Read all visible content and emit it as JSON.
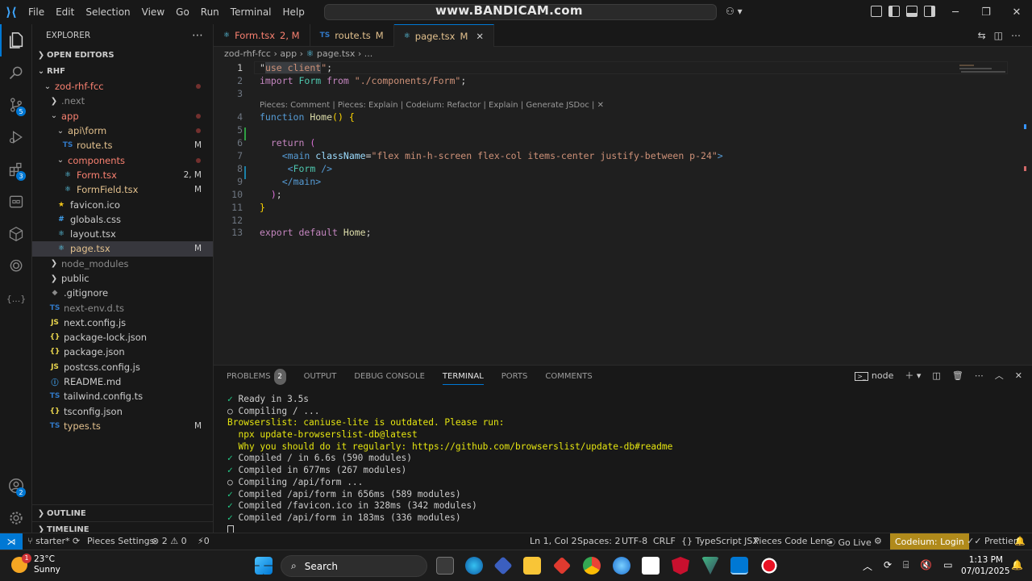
{
  "titlebar": {
    "menu": [
      "File",
      "Edit",
      "Selection",
      "View",
      "Go",
      "Run",
      "Terminal",
      "Help"
    ],
    "watermark": "www.BANDICAM.com"
  },
  "explorer": {
    "title": "EXPLORER",
    "open_editors": "OPEN EDITORS",
    "workspace": "RHF",
    "tree": [
      {
        "label": "zod-rhf-fcc",
        "depth": 0,
        "kind": "folder-open",
        "color": "err",
        "dot": true
      },
      {
        "label": ".next",
        "depth": 1,
        "kind": "folder",
        "color": "dim"
      },
      {
        "label": "app",
        "depth": 1,
        "kind": "folder-open",
        "color": "err",
        "dot": true
      },
      {
        "label": "api\\form",
        "depth": 2,
        "kind": "folder-open",
        "color": "mod",
        "dot": true
      },
      {
        "label": "route.ts",
        "depth": 3,
        "kind": "ts",
        "color": "mod",
        "status": "M"
      },
      {
        "label": "components",
        "depth": 2,
        "kind": "folder-open",
        "color": "err",
        "dot": true
      },
      {
        "label": "Form.tsx",
        "depth": 3,
        "kind": "react",
        "color": "err",
        "status": "2, M"
      },
      {
        "label": "FormField.tsx",
        "depth": 3,
        "kind": "react",
        "color": "mod",
        "status": "M"
      },
      {
        "label": "favicon.ico",
        "depth": 2,
        "kind": "fav",
        "color": "plain"
      },
      {
        "label": "globals.css",
        "depth": 2,
        "kind": "css",
        "color": "plain"
      },
      {
        "label": "layout.tsx",
        "depth": 2,
        "kind": "react",
        "color": "plain"
      },
      {
        "label": "page.tsx",
        "depth": 2,
        "kind": "react",
        "color": "mod",
        "status": "M",
        "selected": true
      },
      {
        "label": "node_modules",
        "depth": 1,
        "kind": "folder",
        "color": "dim"
      },
      {
        "label": "public",
        "depth": 1,
        "kind": "folder",
        "color": "plain"
      },
      {
        "label": ".gitignore",
        "depth": 1,
        "kind": "git",
        "color": "plain"
      },
      {
        "label": "next-env.d.ts",
        "depth": 1,
        "kind": "ts",
        "color": "dim"
      },
      {
        "label": "next.config.js",
        "depth": 1,
        "kind": "js",
        "color": "plain"
      },
      {
        "label": "package-lock.json",
        "depth": 1,
        "kind": "json",
        "color": "plain"
      },
      {
        "label": "package.json",
        "depth": 1,
        "kind": "json",
        "color": "plain"
      },
      {
        "label": "postcss.config.js",
        "depth": 1,
        "kind": "js",
        "color": "plain"
      },
      {
        "label": "README.md",
        "depth": 1,
        "kind": "info",
        "color": "plain"
      },
      {
        "label": "tailwind.config.ts",
        "depth": 1,
        "kind": "ts",
        "color": "plain"
      },
      {
        "label": "tsconfig.json",
        "depth": 1,
        "kind": "json",
        "color": "plain"
      },
      {
        "label": "types.ts",
        "depth": 1,
        "kind": "ts",
        "color": "mod",
        "status": "M"
      }
    ],
    "outline": "OUTLINE",
    "timeline": "TIMELINE"
  },
  "tabs": [
    {
      "label": "Form.tsx",
      "status": "2, M",
      "icon": "react",
      "kind": "err"
    },
    {
      "label": "route.ts",
      "status": "M",
      "icon": "ts",
      "kind": "mod"
    },
    {
      "label": "page.tsx",
      "status": "M",
      "icon": "react",
      "kind": "mod",
      "active": true,
      "close": "✕"
    }
  ],
  "breadcrumb": [
    "zod-rhf-fcc",
    "app",
    "page.tsx",
    "..."
  ],
  "code_lens": "Pieces: Comment | Pieces: Explain | Codeium: Refactor | Explain | Generate JSDoc | ✕",
  "code_lines": [
    {
      "n": "1",
      "tokens": [
        [
          "punc",
          "\""
        ],
        [
          "str hl",
          "use client"
        ],
        [
          "str",
          "\""
        ],
        [
          "punc",
          ";"
        ]
      ]
    },
    {
      "n": "2",
      "tokens": [
        [
          "kw",
          "import"
        ],
        [
          "punc",
          " "
        ],
        [
          "cls",
          "Form"
        ],
        [
          "punc",
          " "
        ],
        [
          "kw",
          "from"
        ],
        [
          "punc",
          " "
        ],
        [
          "str",
          "\"./components/Form\""
        ],
        [
          "punc",
          ";"
        ]
      ]
    },
    {
      "n": "3",
      "tokens": []
    },
    {
      "n": "4",
      "tokens": [
        [
          "kwb",
          "function"
        ],
        [
          "punc",
          " "
        ],
        [
          "fn",
          "Home"
        ],
        [
          "br1",
          "()"
        ],
        [
          "punc",
          " "
        ],
        [
          "br1",
          "{"
        ]
      ]
    },
    {
      "n": "5",
      "tokens": []
    },
    {
      "n": "6",
      "tokens": [
        [
          "punc",
          "  "
        ],
        [
          "kw",
          "return"
        ],
        [
          "punc",
          " "
        ],
        [
          "br2",
          "("
        ]
      ]
    },
    {
      "n": "7",
      "tokens": [
        [
          "punc",
          "    "
        ],
        [
          "tag",
          "<"
        ],
        [
          "tag",
          "main"
        ],
        [
          "punc",
          " "
        ],
        [
          "attr",
          "className"
        ],
        [
          "punc",
          "="
        ],
        [
          "str",
          "\"flex min-h-screen flex-col items-center justify-between p-24\""
        ],
        [
          "tag",
          ">"
        ]
      ]
    },
    {
      "n": "8",
      "tokens": [
        [
          "punc",
          "     "
        ],
        [
          "tag",
          "<"
        ],
        [
          "cls",
          "Form"
        ],
        [
          "punc",
          " "
        ],
        [
          "tag",
          "/>"
        ]
      ]
    },
    {
      "n": "9",
      "tokens": [
        [
          "punc",
          "    "
        ],
        [
          "tag",
          "</"
        ],
        [
          "tag",
          "main"
        ],
        [
          "tag",
          ">"
        ]
      ]
    },
    {
      "n": "10",
      "tokens": [
        [
          "punc",
          "  "
        ],
        [
          "br2",
          ")"
        ],
        [
          "punc",
          ";"
        ]
      ]
    },
    {
      "n": "11",
      "tokens": [
        [
          "br1",
          "}"
        ]
      ]
    },
    {
      "n": "12",
      "tokens": []
    },
    {
      "n": "13",
      "tokens": [
        [
          "kw",
          "export"
        ],
        [
          "punc",
          " "
        ],
        [
          "kw",
          "default"
        ],
        [
          "punc",
          " "
        ],
        [
          "fn",
          "Home"
        ],
        [
          "punc",
          ";"
        ]
      ]
    }
  ],
  "panel": {
    "tabs": [
      "PROBLEMS",
      "OUTPUT",
      "DEBUG CONSOLE",
      "TERMINAL",
      "PORTS",
      "COMMENTS"
    ],
    "problems_count": "2",
    "shell": "node",
    "terminal_lines": [
      {
        "mark": "✓",
        "text": " Ready in 3.5s",
        "style": "plain"
      },
      {
        "mark": "○",
        "text": " Compiling / ...",
        "style": "plain"
      },
      {
        "mark": "",
        "text": "Browserslist: caniuse-lite is outdated. Please run:",
        "style": "ylw"
      },
      {
        "mark": "",
        "text": "  npx update-browserslist-db@latest",
        "style": "ylw"
      },
      {
        "mark": "",
        "text": "  Why you should do it regularly: https://github.com/browserslist/update-db#readme",
        "style": "ylw"
      },
      {
        "mark": "✓",
        "text": " Compiled / in 6.6s (590 modules)",
        "style": "plain"
      },
      {
        "mark": "✓",
        "text": " Compiled in 677ms (267 modules)",
        "style": "plain"
      },
      {
        "mark": "○",
        "text": " Compiling /api/form ...",
        "style": "plain"
      },
      {
        "mark": "✓",
        "text": " Compiled /api/form in 656ms (589 modules)",
        "style": "plain"
      },
      {
        "mark": "✓",
        "text": " Compiled /favicon.ico in 328ms (342 modules)",
        "style": "plain"
      },
      {
        "mark": "✓",
        "text": " Compiled /api/form in 183ms (336 modules)",
        "style": "plain"
      }
    ]
  },
  "statusbar": {
    "branch": "starter*",
    "pieces": "Pieces Settings",
    "errors": "2",
    "warnings": "0",
    "ports": "0",
    "position": "Ln 1, Col 2",
    "spaces": "Spaces: 2",
    "encoding": "UTF-8",
    "eol": "CRLF",
    "language": "TypeScript JSX",
    "lens": "Pieces Code Lens",
    "golive": "Go Live",
    "codeium": "Codeium: Login",
    "prettier": "Prettier"
  },
  "taskbar": {
    "temperature": "23°C",
    "weather": "Sunny",
    "weather_badge": "1",
    "search_placeholder": "Search",
    "time": "1:13 PM",
    "date": "07/01/2025"
  },
  "activity_badges": {
    "scm": "5",
    "extensions": "3",
    "accounts": "2"
  }
}
